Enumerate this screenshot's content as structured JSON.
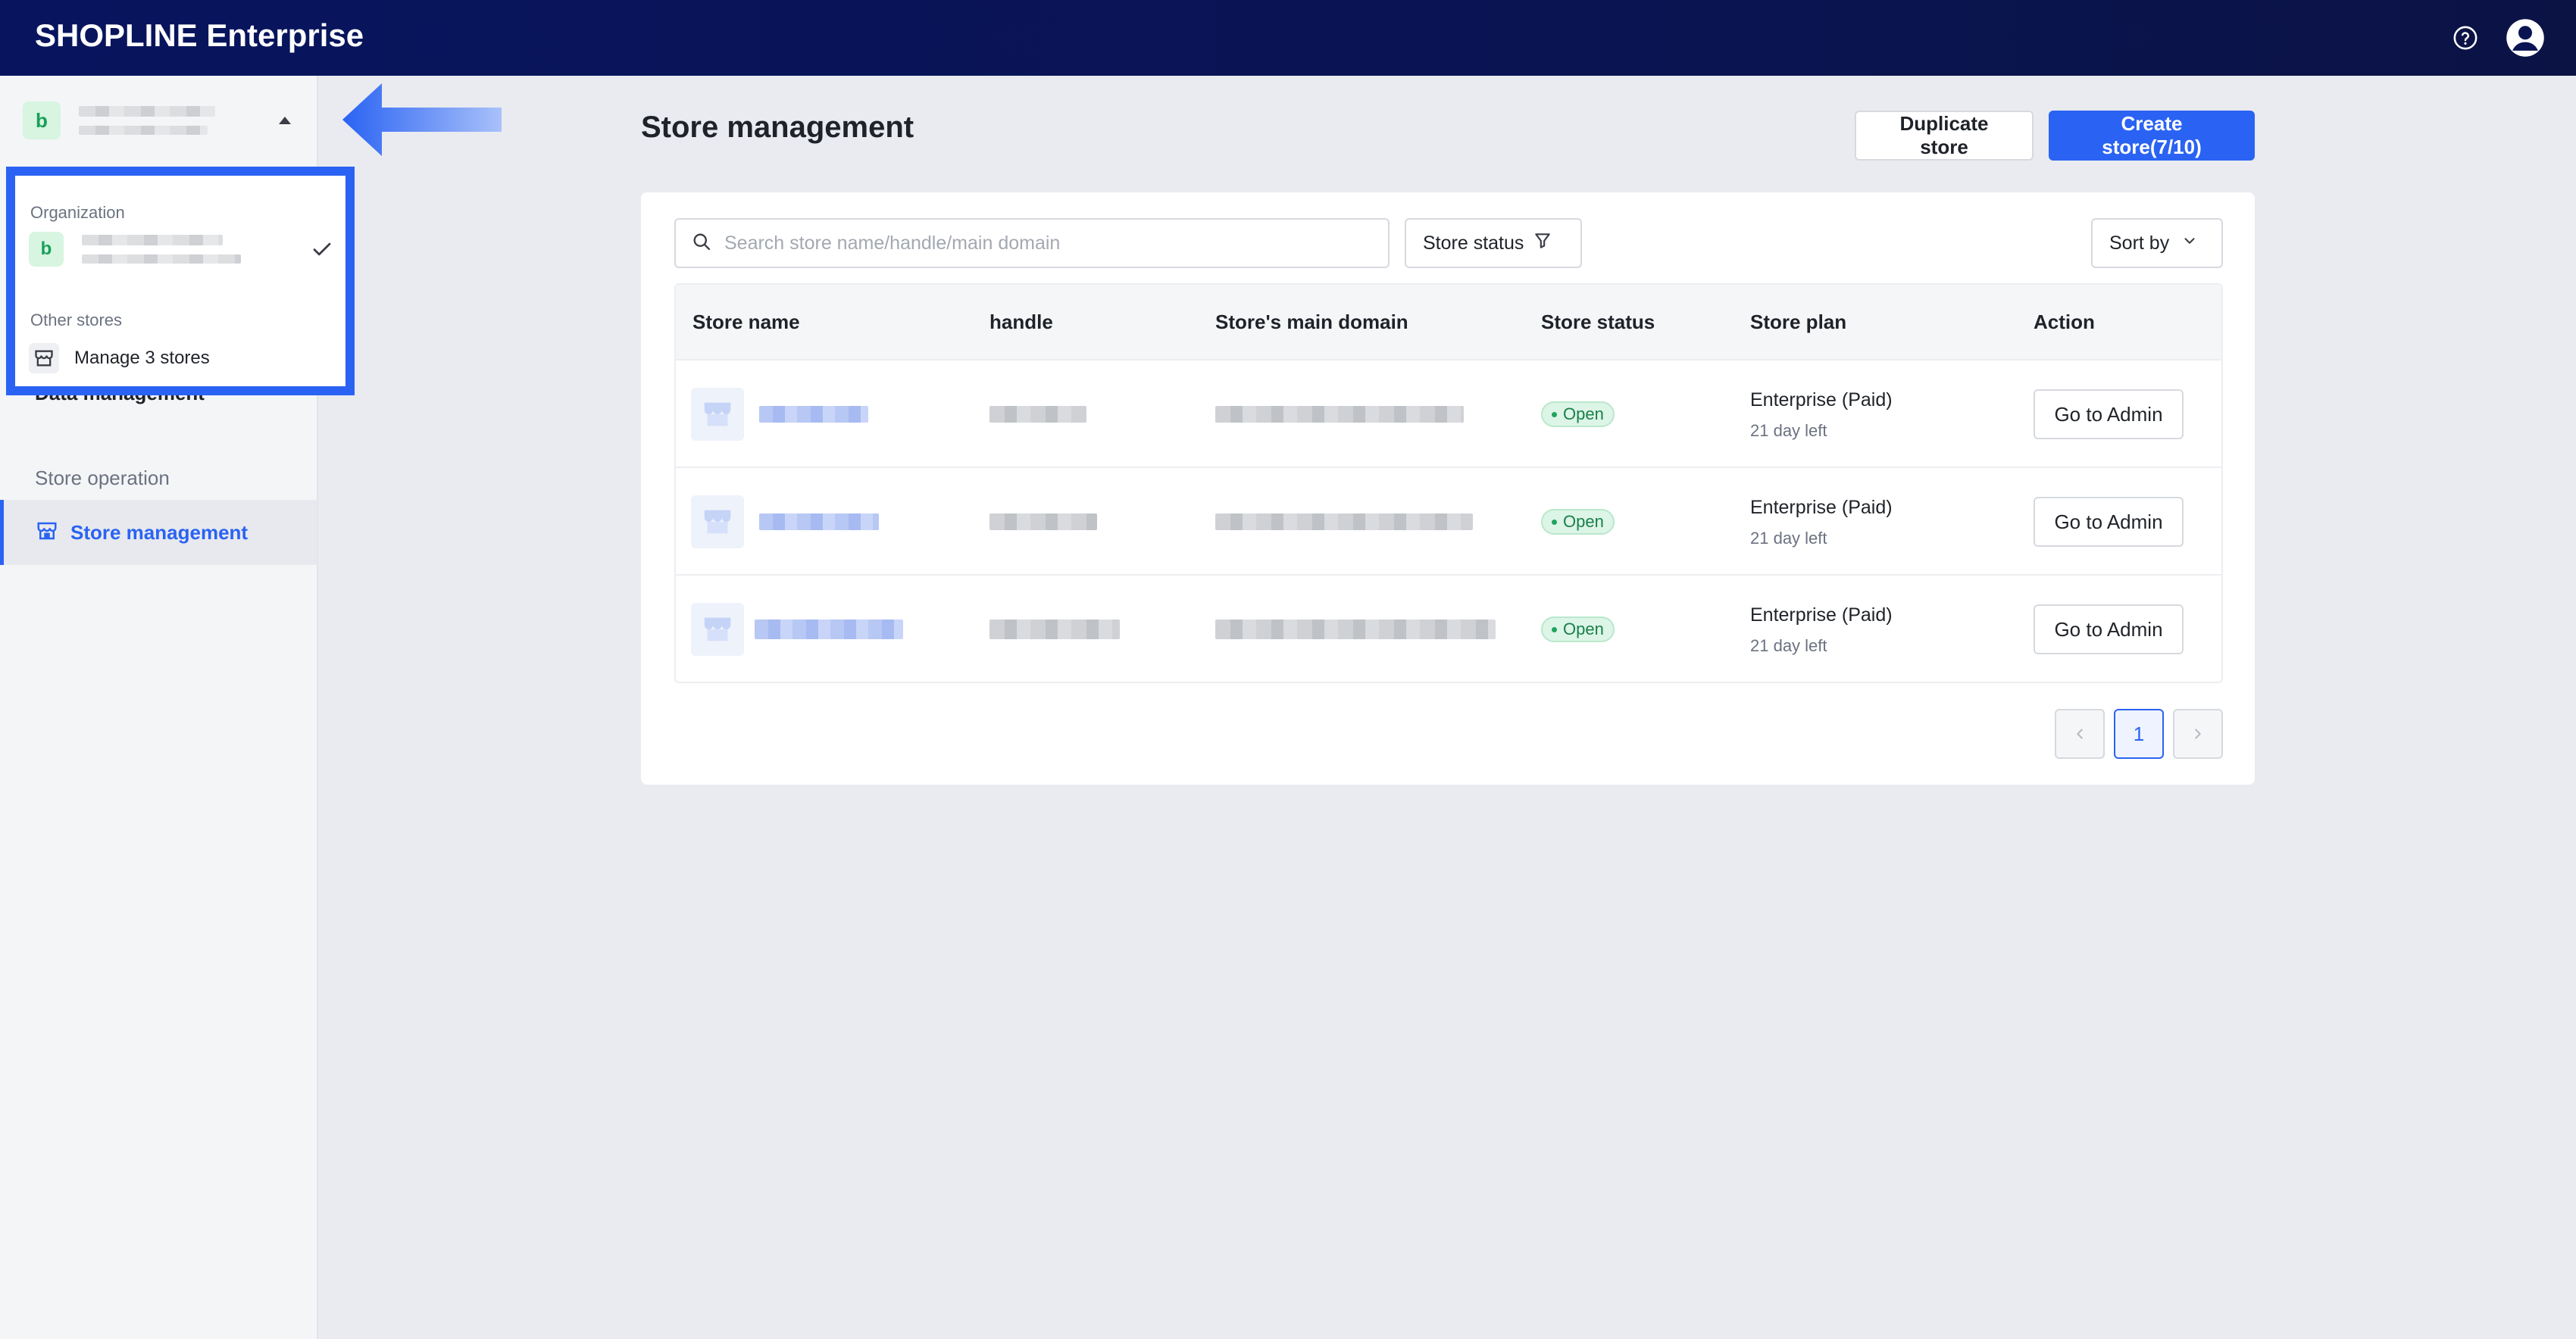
{
  "app": {
    "brand": "SHOPLINE Enterprise"
  },
  "sidebar": {
    "org_avatar_letter": "b",
    "dropdown": {
      "organization_label": "Organization",
      "org_avatar_letter": "b",
      "other_stores_label": "Other stores",
      "manage_stores_label": "Manage 3 stores"
    },
    "data_management_label": "Data management",
    "section_title": "Store operation",
    "active_item_label": "Store management"
  },
  "main": {
    "title": "Store management",
    "duplicate_button": "Duplicate store",
    "create_button": "Create store(7/10)",
    "search": {
      "placeholder": "Search store name/handle/main domain",
      "value": ""
    },
    "filter_label": "Store status",
    "sort_label": "Sort by",
    "table": {
      "headers": [
        "Store name",
        "handle",
        "Store's main domain",
        "Store status",
        "Store plan",
        "Action"
      ],
      "rows": [
        {
          "status": "Open",
          "plan": "Enterprise (Paid)",
          "days_left": "21 day left",
          "action": "Go to Admin"
        },
        {
          "status": "Open",
          "plan": "Enterprise (Paid)",
          "days_left": "21 day left",
          "action": "Go to Admin"
        },
        {
          "status": "Open",
          "plan": "Enterprise (Paid)",
          "days_left": "21 day left",
          "action": "Go to Admin"
        }
      ]
    },
    "pagination": {
      "current_page": "1"
    }
  },
  "colors": {
    "topbar": "#08155e",
    "accent": "#2a63f3",
    "open_badge": "#dcf5e6"
  },
  "icons": [
    "help-icon",
    "account-icon",
    "caret-up-icon",
    "check-icon",
    "store-icon",
    "search-icon",
    "filter-icon",
    "chevron-down-icon",
    "chevron-left-icon",
    "chevron-right-icon"
  ]
}
